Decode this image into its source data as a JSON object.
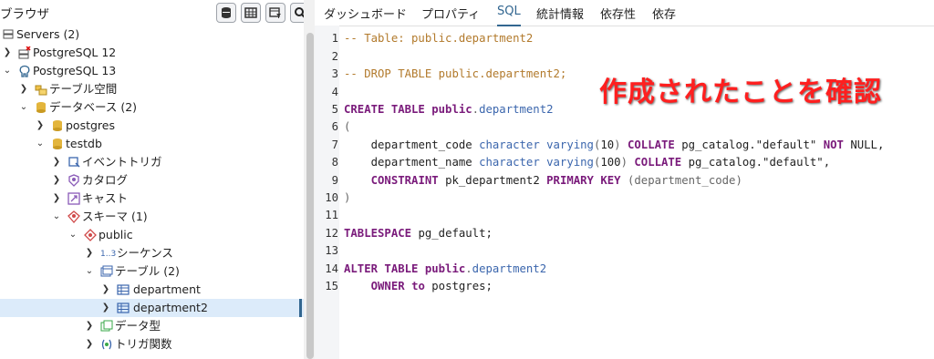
{
  "browser": {
    "title": "ブラウザ",
    "toolbar": [
      "database-query-icon",
      "table-view-icon",
      "filter-icon",
      "search-icon"
    ]
  },
  "tree": [
    {
      "label": "Servers (2)"
    },
    {
      "label": "PostgreSQL 12"
    },
    {
      "label": "PostgreSQL 13"
    },
    {
      "label": "テーブル空間"
    },
    {
      "label": "データベース (2)"
    },
    {
      "label": "postgres"
    },
    {
      "label": "testdb"
    },
    {
      "label": "イベントトリガ"
    },
    {
      "label": "カタログ"
    },
    {
      "label": "キャスト"
    },
    {
      "label": "スキーマ (1)"
    },
    {
      "label": "public"
    },
    {
      "label": "シーケンス"
    },
    {
      "label": "テーブル (2)"
    },
    {
      "label": "department"
    },
    {
      "label": "department2"
    },
    {
      "label": "データ型"
    },
    {
      "label": "トリガ関数"
    }
  ],
  "tabs": {
    "dashboard": "ダッシュボード",
    "properties": "プロパティ",
    "sql": "SQL",
    "statistics": "統計情報",
    "dependencies": "依存性",
    "dependents": "依存"
  },
  "sql": {
    "line_numbers": [
      "1",
      "2",
      "3",
      "4",
      "5",
      "6",
      "7",
      "8",
      "9",
      "10",
      "11",
      "12",
      "13",
      "14",
      "15"
    ],
    "comment1": "-- Table: public.department2",
    "comment2": "-- DROP TABLE public.department2;",
    "kw_create": "CREATE TABLE",
    "public1": "public",
    "tbl1": "department2",
    "paren_open": "(",
    "col1_name": "department_code",
    "col1_type": "character varying",
    "col1_len": "10",
    "col1_rest": "COLLATE",
    "col1_coll": "pg_catalog.\"default\"",
    "col1_nn": "NOT",
    "col1_null": "NULL,",
    "col2_name": "department_name",
    "col2_type": "character varying",
    "col2_len": "100",
    "col2_coll": "pg_catalog.\"default\",",
    "kw_constraint": "CONSTRAINT",
    "pk_name": "pk_department2",
    "kw_pk": "PRIMARY KEY",
    "pk_cols": "(department_code)",
    "paren_close": ")",
    "kw_tablespace": "TABLESPACE",
    "tablespace": "pg_default;",
    "kw_alter": "ALTER TABLE",
    "public2": "public",
    "tbl2": "department2",
    "kw_owner": "OWNER",
    "kw_to": "to",
    "owner": "postgres;"
  },
  "annotation": "作成されたことを確認",
  "colors": {
    "keyword": "#7a1b7b",
    "comment": "#b27a2c",
    "type": "#3b66ad",
    "annotation": "#ff1f1f",
    "selection": "#dcebfa",
    "accent": "#326690"
  }
}
